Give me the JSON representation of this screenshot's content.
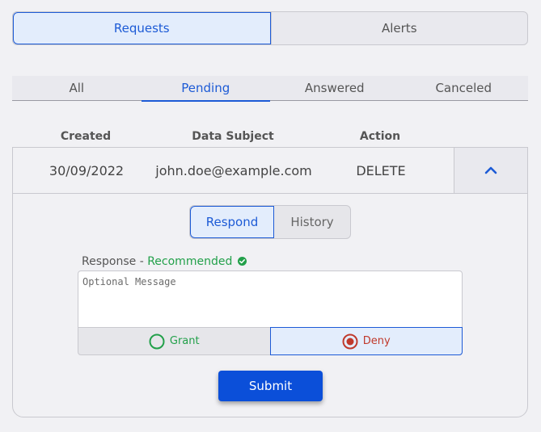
{
  "top_tabs": {
    "requests": "Requests",
    "alerts": "Alerts"
  },
  "filter_tabs": {
    "all": "All",
    "pending": "Pending",
    "answered": "Answered",
    "canceled": "Canceled"
  },
  "table": {
    "headers": {
      "created": "Created",
      "data_subject": "Data Subject",
      "action": "Action"
    },
    "row": {
      "created": "30/09/2022",
      "data_subject": "john.doe@example.com",
      "action": "DELETE"
    }
  },
  "detail": {
    "tabs": {
      "respond": "Respond",
      "history": "History"
    },
    "response_label": "Response - ",
    "recommended": "Recommended",
    "message_placeholder": "Optional Message",
    "grant": "Grant",
    "deny": "Deny",
    "selected": "Deny",
    "submit": "Submit"
  },
  "colors": {
    "accent": "#1d5bd6",
    "submit": "#0b4fd9",
    "grant": "#22a04a",
    "deny": "#c0392b"
  },
  "icons": {
    "collapse": "chevron-up-icon",
    "recommended": "check-circle-icon",
    "grant": "radio-unchecked-icon",
    "deny": "radio-checked-icon"
  }
}
